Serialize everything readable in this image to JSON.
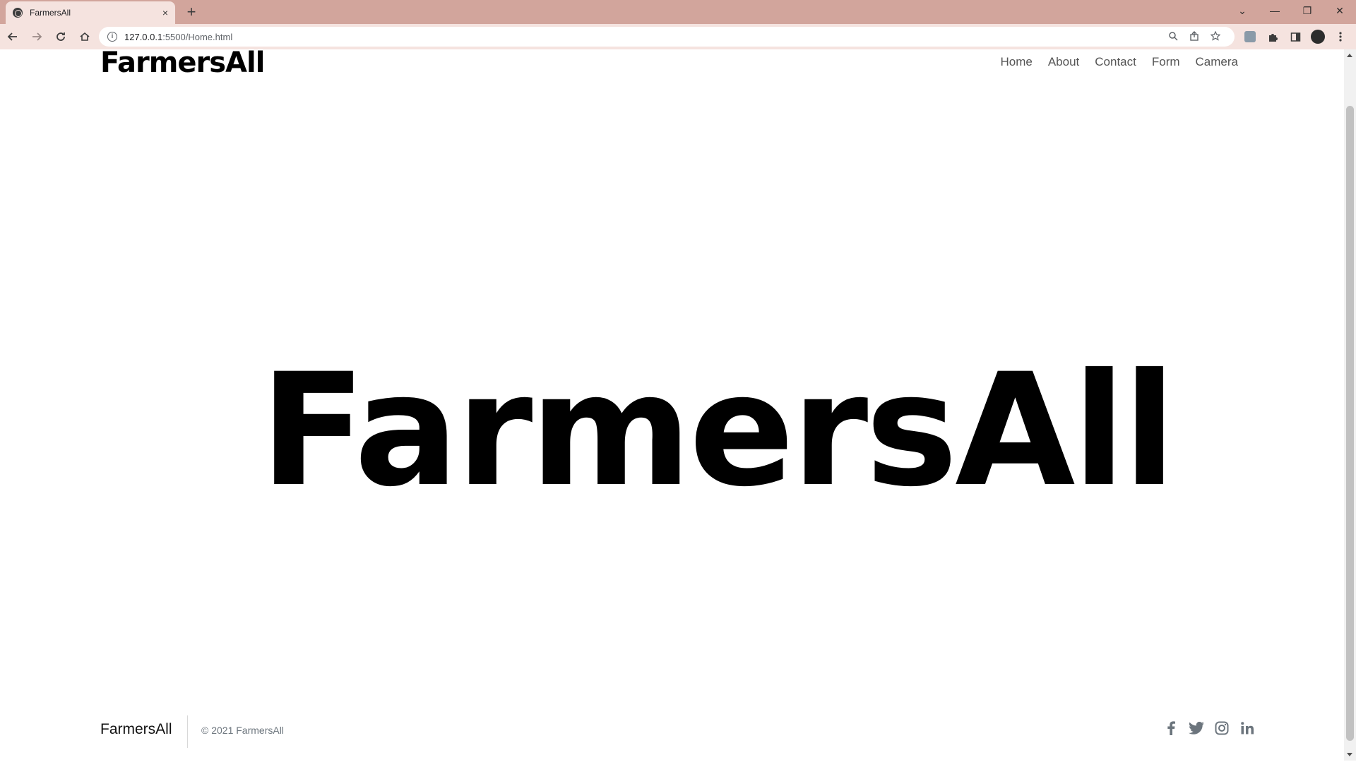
{
  "browser": {
    "tab_title": "FarmersAll",
    "tab_close": "×",
    "new_tab": "+",
    "url_host": "127.0.0.1",
    "url_path": ":5500/Home.html",
    "window_controls": [
      "⌄",
      "—",
      "❐",
      "✕"
    ]
  },
  "header": {
    "logo_text": "FarmersAll",
    "nav": [
      "Home",
      "About",
      "Contact",
      "Form",
      "Camera"
    ]
  },
  "hero": {
    "logo_text": "FarmersAll"
  },
  "footer": {
    "brand": "FarmersAll",
    "copyright": "© 2021 FarmersAll",
    "social_icons": [
      "facebook-icon",
      "twitter-icon",
      "instagram-icon",
      "linkedin-icon"
    ]
  },
  "colors": {
    "tabstrip": "#d2a59c",
    "toolbar": "#f5e3df",
    "nav_text": "#555555",
    "footer_muted": "#6c757d"
  }
}
